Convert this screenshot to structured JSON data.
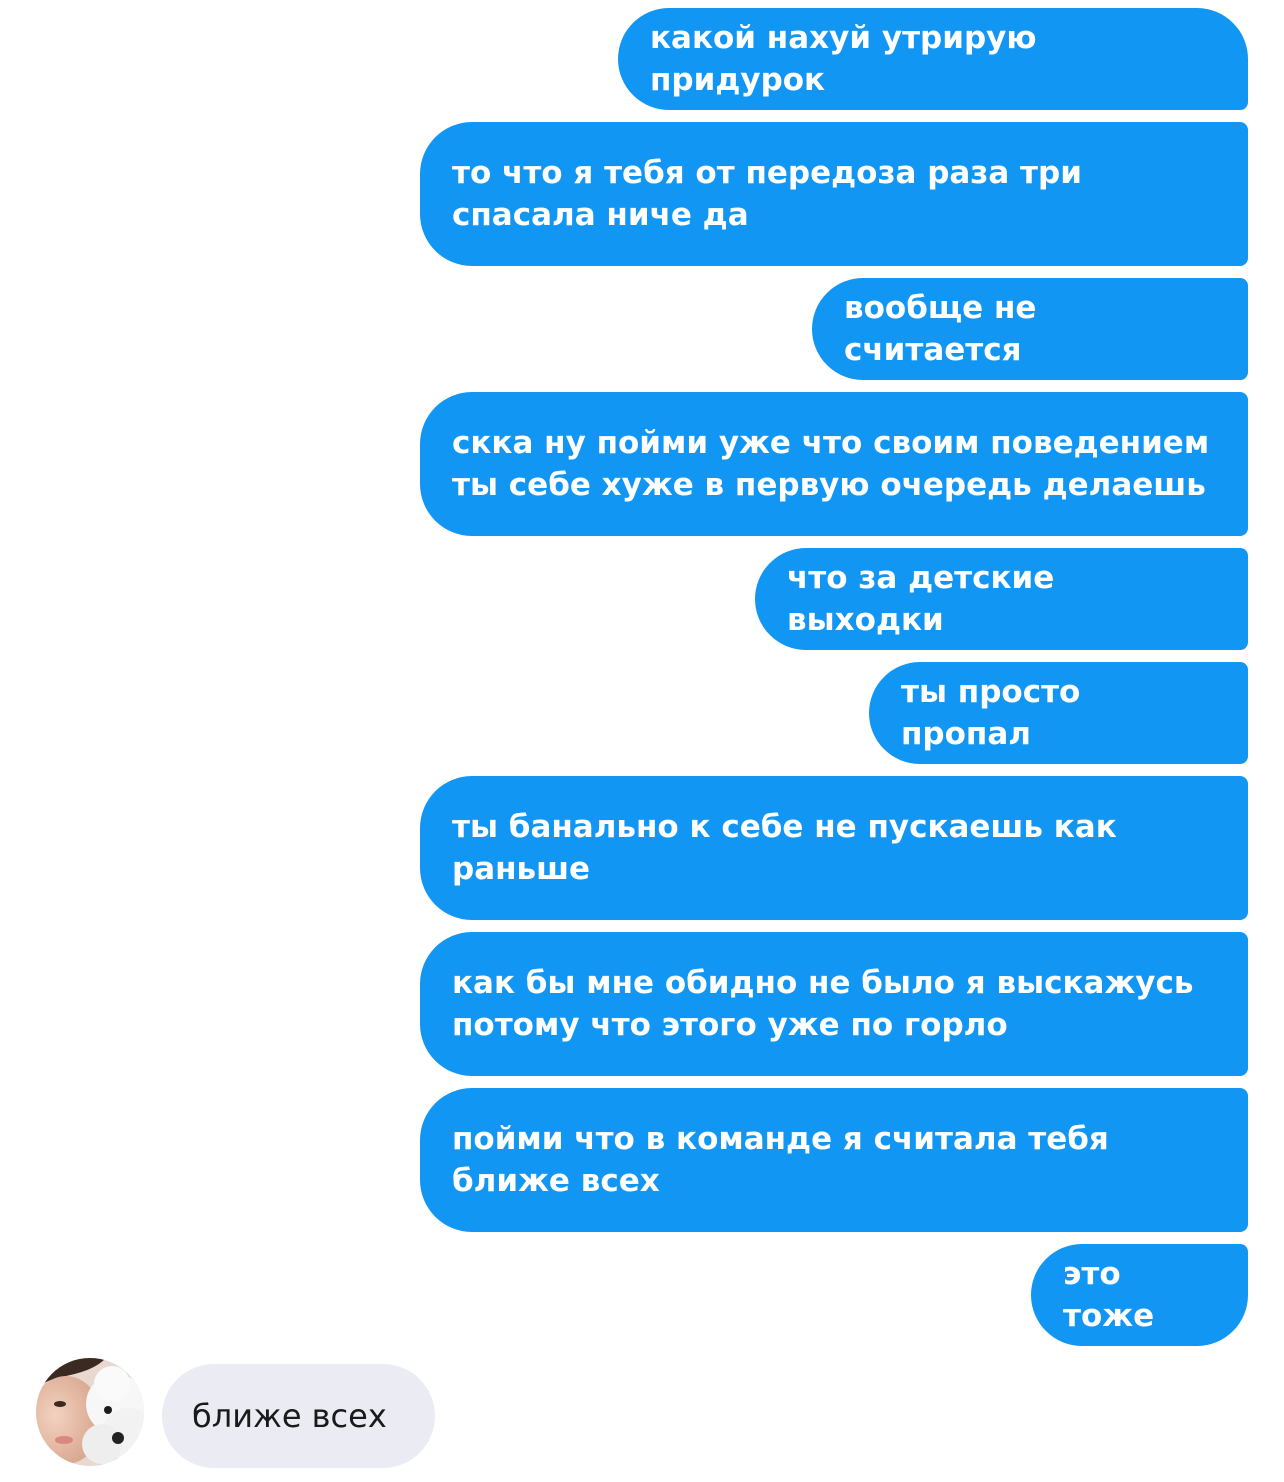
{
  "messages": {
    "m1": "какой нахуй утрирую придурок",
    "m2": "то что я тебя от передоза раза три спасала ниче да",
    "m3": "вообще не считается",
    "m4": "скка ну пойми уже что своим поведением ты себе хуже в первую очередь делаешь",
    "m5": "что за детские выходки",
    "m6": "ты просто пропал",
    "m7": "ты банально к себе не пускаешь как раньше",
    "m8": "как бы мне обидно не было я выскажусь потому что этого уже по горло",
    "m9": "пойми что в команде я считала тебя ближе всех",
    "m10": "это тоже",
    "reply": "ближе всех"
  },
  "colors": {
    "outgoing_bubble": "#1296f4",
    "incoming_bubble": "#ebebf3",
    "outgoing_text": "#ffffff",
    "incoming_text": "#1a1a1a"
  },
  "icons": {
    "contact_avatar": "avatar-photo"
  }
}
